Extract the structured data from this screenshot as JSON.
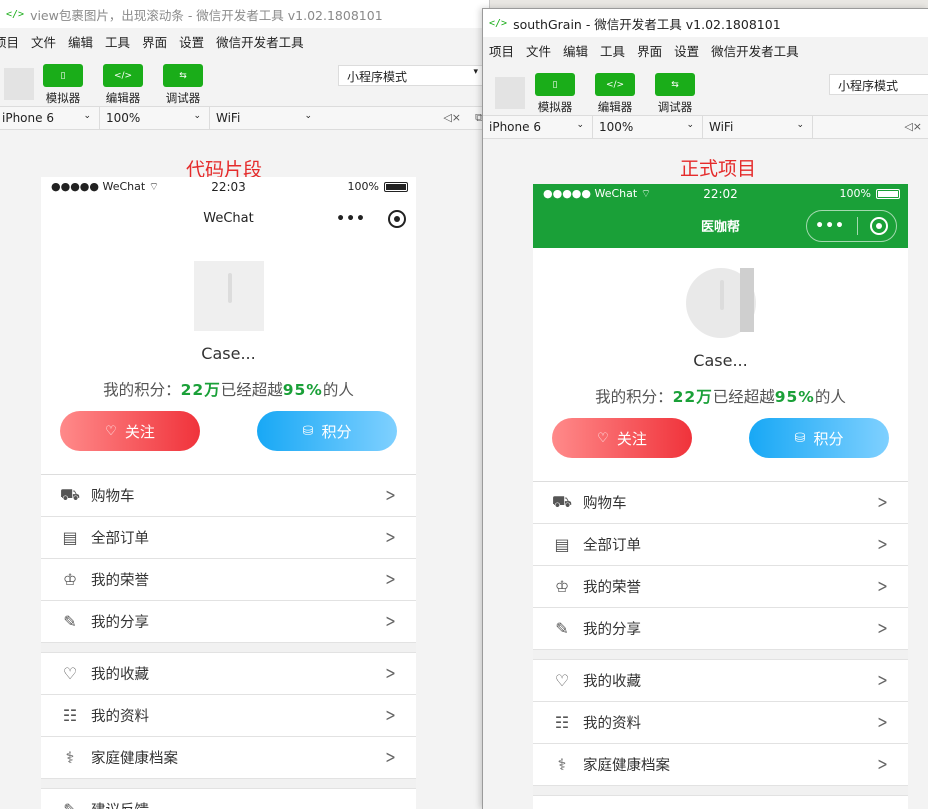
{
  "window1": {
    "title": "view包裹图片，出现滚动条 - 微信开发者工具 v1.02.1808101",
    "menu": [
      "项目",
      "文件",
      "编辑",
      "工具",
      "界面",
      "设置",
      "微信开发者工具"
    ],
    "tools": [
      {
        "label": "模拟器",
        "icon": "phone-icon"
      },
      {
        "label": "编辑器",
        "icon": "code-icon"
      },
      {
        "label": "调试器",
        "icon": "debug-icon"
      }
    ],
    "mode": "小程序模式",
    "device": "iPhone 6",
    "zoom": "100%",
    "network": "WiFi",
    "caption": "代码片段"
  },
  "window2": {
    "title": "southGrain - 微信开发者工具 v1.02.1808101",
    "menu": [
      "项目",
      "文件",
      "编辑",
      "工具",
      "界面",
      "设置",
      "微信开发者工具"
    ],
    "tools": [
      {
        "label": "模拟器",
        "icon": "phone-icon"
      },
      {
        "label": "编辑器",
        "icon": "code-icon"
      },
      {
        "label": "调试器",
        "icon": "debug-icon"
      }
    ],
    "mode": "小程序模式",
    "device": "iPhone 6",
    "zoom": "100%",
    "network": "WiFi",
    "caption": "正式项目"
  },
  "phone1": {
    "carrier": "●●●●● WeChat",
    "time": "22:03",
    "battery": "100%",
    "nav_title": "WeChat",
    "name": "Case...",
    "points_prefix": "我的积分：",
    "points_value": "22万",
    "points_mid": "已经超越",
    "points_percent": "95%",
    "points_suffix": "的人",
    "follow_label": "关注",
    "score_label": "积分",
    "menu_group1": [
      {
        "label": "购物车",
        "icon": "cart-icon"
      },
      {
        "label": "全部订单",
        "icon": "orders-icon"
      },
      {
        "label": "我的荣誉",
        "icon": "crown-icon"
      },
      {
        "label": "我的分享",
        "icon": "share-icon"
      }
    ],
    "menu_group2": [
      {
        "label": "我的收藏",
        "icon": "heart-icon"
      },
      {
        "label": "我的资料",
        "icon": "profile-icon"
      },
      {
        "label": "家庭健康档案",
        "icon": "health-record-icon"
      }
    ],
    "menu_partial": "建议反馈"
  },
  "phone2": {
    "carrier": "●●●●● WeChat",
    "time": "22:02",
    "battery": "100%",
    "nav_title": "医咖帮",
    "name": "Case...",
    "points_prefix": "我的积分：",
    "points_value": "22万",
    "points_mid": "已经超越",
    "points_percent": "95%",
    "points_suffix": "的人",
    "follow_label": "关注",
    "score_label": "积分",
    "menu_group1": [
      {
        "label": "购物车",
        "icon": "cart-icon"
      },
      {
        "label": "全部订单",
        "icon": "orders-icon"
      },
      {
        "label": "我的荣誉",
        "icon": "crown-icon"
      },
      {
        "label": "我的分享",
        "icon": "share-icon"
      }
    ],
    "menu_group2": [
      {
        "label": "我的收藏",
        "icon": "heart-icon"
      },
      {
        "label": "我的资料",
        "icon": "profile-icon"
      },
      {
        "label": "家庭健康档案",
        "icon": "health-record-icon"
      }
    ]
  },
  "colors": {
    "wechat_green": "#1aad19",
    "nav_green": "#1aa038",
    "caption_red": "#e52b2b",
    "follow_red": "#f0333b",
    "score_blue": "#18a8f5"
  }
}
